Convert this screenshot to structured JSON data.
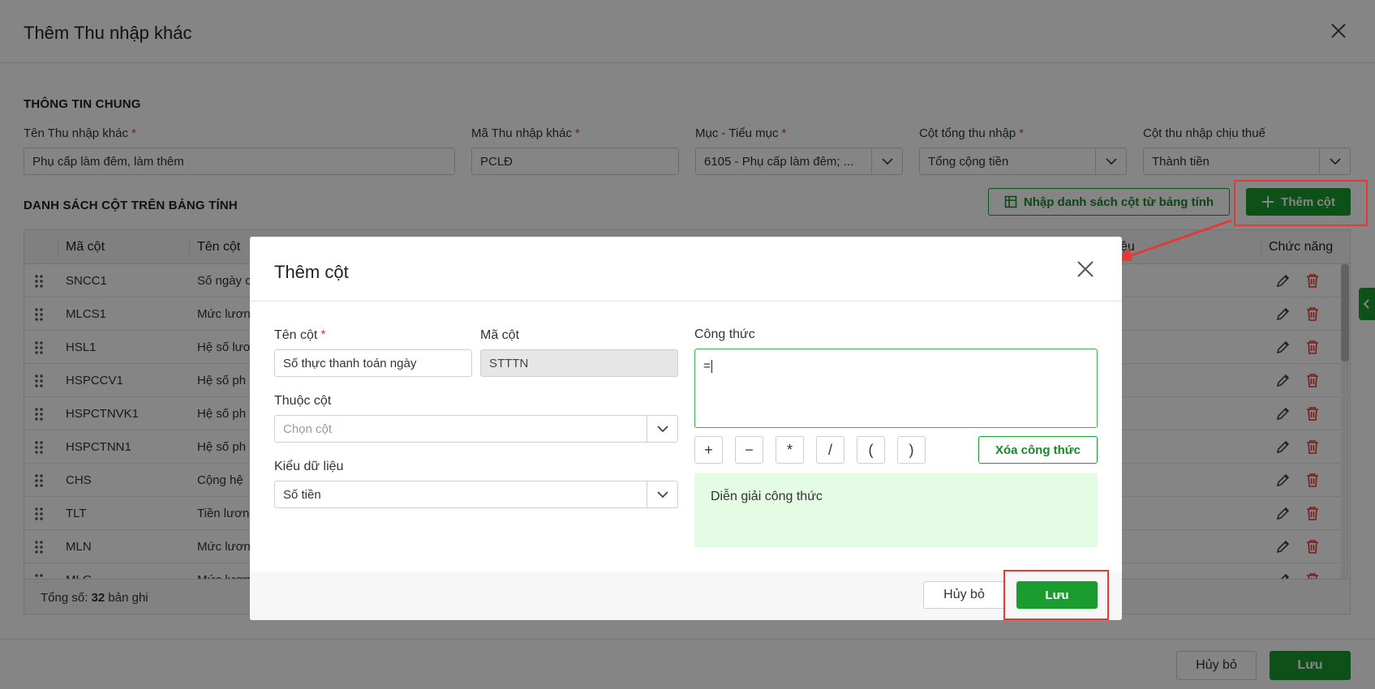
{
  "page": {
    "title": "Thêm Thu nhập khác",
    "general_section": "THÔNG TIN CHUNG",
    "fields": {
      "name_label": "Tên Thu nhập khác",
      "name_value": "Phụ cấp làm đêm, làm thêm",
      "code_label": "Mã Thu nhập khác",
      "code_value": "PCLĐ",
      "category_label": "Mục - Tiểu mục",
      "category_value": "6105 - Phụ cấp làm đêm; ...",
      "total_col_label": "Cột tổng thu nhập",
      "total_col_value": "Tổng cộng tiền",
      "taxable_col_label": "Cột thu nhập chịu thuế",
      "taxable_col_value": "Thành tiền"
    },
    "list_section": "DANH SÁCH CỘT TRÊN BẢNG TÍNH",
    "import_button": "Nhập danh sách cột từ bảng tính",
    "add_column_button": "Thêm cột",
    "table": {
      "col_code": "Mã cột",
      "col_name": "Tên cột",
      "col_partial": "ệu",
      "col_actions": "Chức năng",
      "rows": [
        {
          "code": "SNCC1",
          "name": "Số ngày c"
        },
        {
          "code": "MLCS1",
          "name": "Mức lươn"
        },
        {
          "code": "HSL1",
          "name": "Hệ số lươ"
        },
        {
          "code": "HSPCCV1",
          "name": "Hệ số ph"
        },
        {
          "code": "HSPCTNVK1",
          "name": "Hệ số ph"
        },
        {
          "code": "HSPCTNN1",
          "name": "Hệ số ph"
        },
        {
          "code": "CHS",
          "name": "Cộng hệ"
        },
        {
          "code": "TLT",
          "name": "Tiền lươn"
        },
        {
          "code": "MLN",
          "name": "Mức lươn"
        },
        {
          "code": "MLG",
          "name": "Mức lươn"
        }
      ],
      "total_prefix": "Tổng số: ",
      "total_count": "32",
      "total_suffix": " bản ghi"
    },
    "footer": {
      "cancel": "Hủy bỏ",
      "save": "Lưu"
    }
  },
  "modal": {
    "title": "Thêm cột",
    "column_name_label": "Tên cột",
    "column_name_value": "Số thực thanh toán ngày",
    "column_code_label": "Mã cột",
    "column_code_value": "STTTN",
    "parent_label": "Thuộc cột",
    "parent_placeholder": "Chọn cột",
    "datatype_label": "Kiểu dữ liệu",
    "datatype_value": "Số tiền",
    "formula_label": "Công thức",
    "formula_value": "=",
    "operators": [
      "+",
      "−",
      "*",
      "/",
      "(",
      ")"
    ],
    "clear_formula": "Xóa công thức",
    "explain_text": "Diễn giải công thức",
    "cancel": "Hủy bỏ",
    "save": "Lưu"
  },
  "colors": {
    "brand_green": "#1a9c2e",
    "highlight_red": "#e53935",
    "explain_bg": "#e4fbe4"
  }
}
